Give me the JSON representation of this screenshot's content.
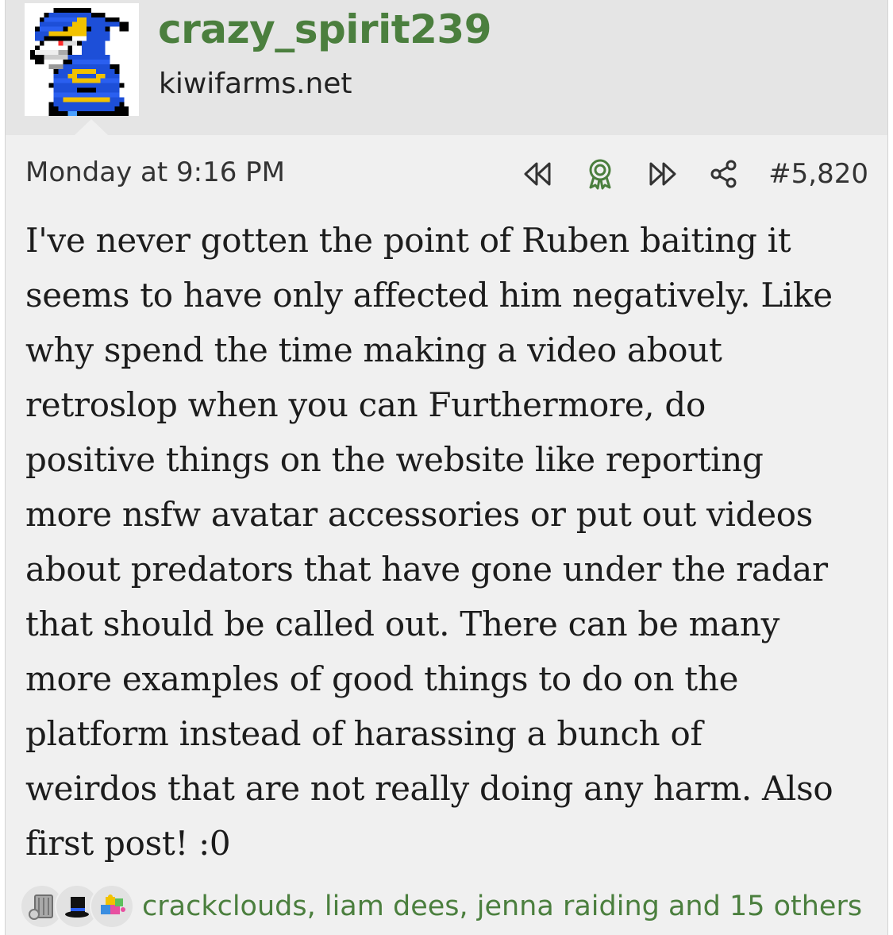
{
  "user": {
    "username": "crazy_spirit239",
    "site": "kiwifarms.net",
    "avatar_icon": "pixel-wizard-avatar"
  },
  "post": {
    "timestamp": "Monday at 9:16 PM",
    "number": "#5,820",
    "body_lines": [
      "I've never gotten the point of Ruben baiting it",
      "seems to have only affected him negatively. Like",
      "why spend the time making a video about",
      "retroslop when you can Furthermore, do",
      "positive things on the website like reporting",
      "more nsfw avatar accessories or put out videos",
      "about predators that have gone under the radar",
      "that should be called out. There can be many",
      "more examples of good things to do on the",
      "platform instead of harassing a bunch of",
      "weirdos that are not really doing any harm. Also",
      "first post! :0"
    ]
  },
  "actions": {
    "icons": [
      "rewind-icon",
      "award-ribbon-icon",
      "fast-forward-icon",
      "share-icon"
    ],
    "accent_color": "#4b7f3e"
  },
  "reactions": {
    "icons": [
      "trash-can-reaction-icon",
      "top-hat-reaction-icon",
      "puzzle-piece-reaction-icon"
    ],
    "text": "crackclouds, liam dees, jenna raiding and 15 others"
  }
}
